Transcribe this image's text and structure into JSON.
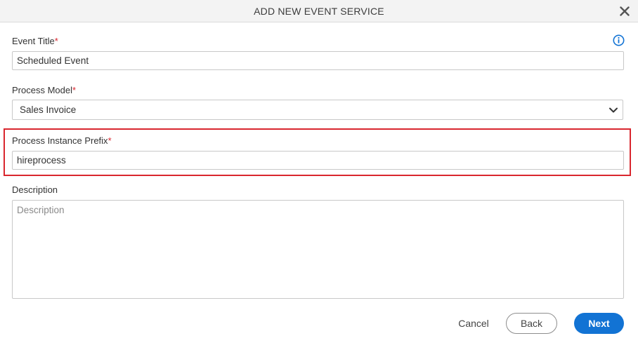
{
  "dialog": {
    "title": "ADD NEW EVENT SERVICE",
    "close_icon": "close-icon",
    "info_icon": "info-icon"
  },
  "form": {
    "event_title": {
      "label": "Event Title",
      "required_mark": "*",
      "value": "Scheduled Event"
    },
    "process_model": {
      "label": "Process Model",
      "required_mark": "*",
      "selected": "Sales Invoice",
      "icon": "chevron-down-icon"
    },
    "process_instance_prefix": {
      "label": "Process Instance Prefix",
      "required_mark": "*",
      "value": "hireprocess"
    },
    "description": {
      "label": "Description",
      "placeholder": "Description",
      "value": ""
    }
  },
  "footer": {
    "cancel_label": "Cancel",
    "back_label": "Back",
    "next_label": "Next"
  },
  "colors": {
    "header_bg": "#f3f3f3",
    "required": "#d9262e",
    "highlight_border": "#d9262e",
    "primary": "#1273d4",
    "info_icon": "#1273d4"
  }
}
